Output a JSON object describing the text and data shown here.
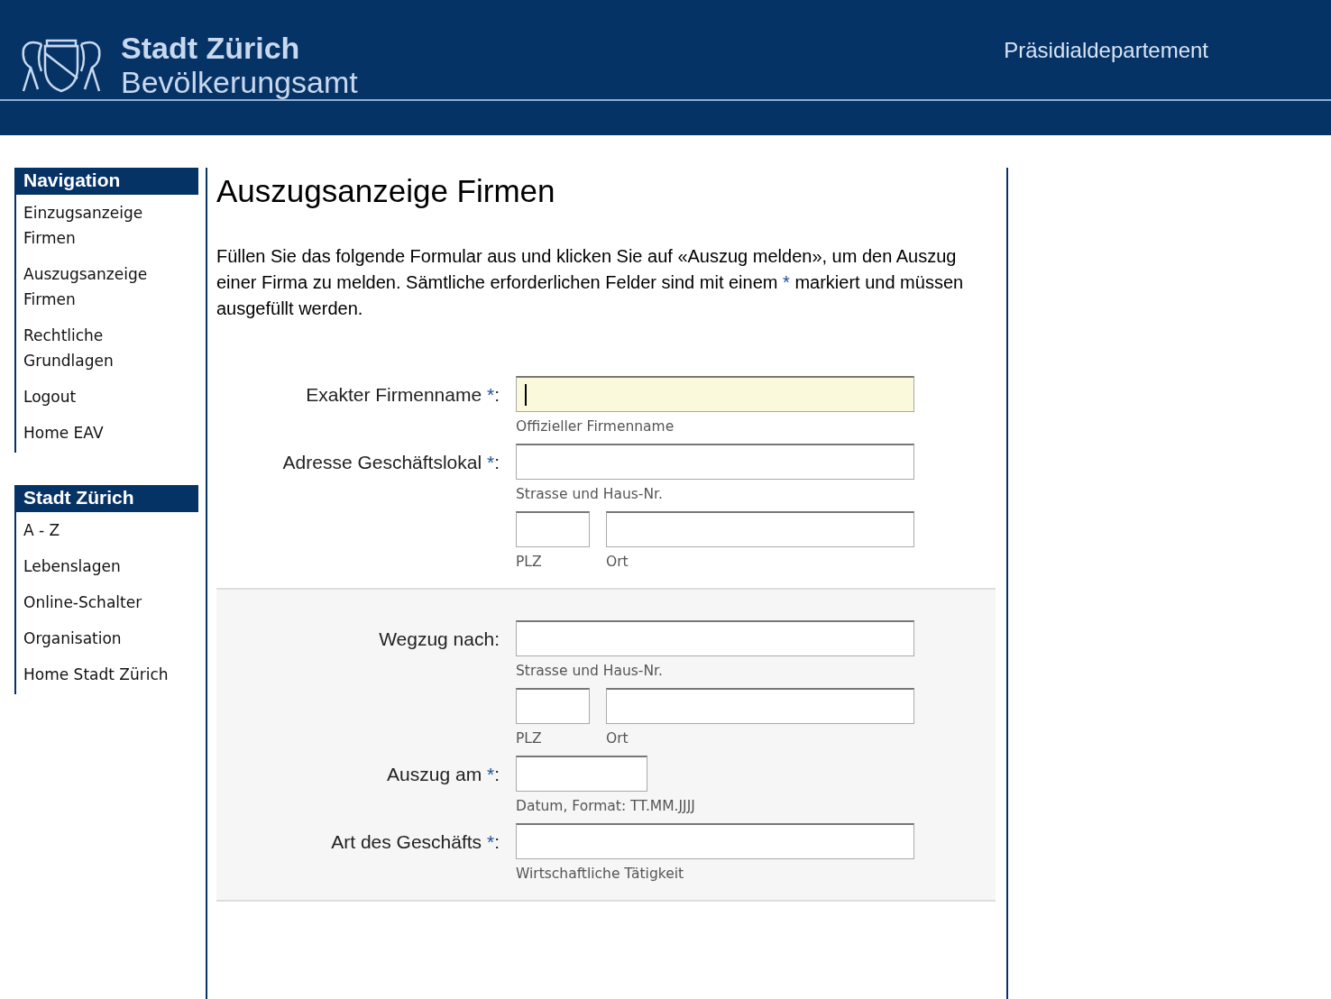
{
  "header": {
    "city": "Stadt Zürich",
    "office": "Bevölkerungsamt",
    "department": "Präsidialdepartement"
  },
  "sidebar": [
    {
      "title": "Navigation",
      "items": [
        "Einzugsanzeige Firmen",
        "Auszugsanzeige Firmen",
        "Rechtliche Grundlagen",
        "Logout",
        "Home EAV"
      ]
    },
    {
      "title": "Stadt Zürich",
      "items": [
        "A - Z",
        "Lebenslagen",
        "Online-Schalter",
        "Organisation",
        "Home Stadt Zürich"
      ]
    }
  ],
  "page": {
    "title": "Auszugsanzeige Firmen",
    "intro": {
      "before": "Füllen Sie das folgende Formular aus und klicken Sie auf «Auszug melden», um den Auszug einer Firma zu melden. Sämtliche erforderlichen Felder sind mit einem ",
      "mark": "*",
      "after": " markiert und müssen ausgefüllt werden."
    }
  },
  "sections": [
    {
      "shaded": false,
      "rows": [
        {
          "kind": "single",
          "label": "Exakter Firmenname ",
          "mark": "*",
          "suffix": ":",
          "focused": true,
          "help": "Offizieller Firmenname"
        },
        {
          "kind": "single",
          "label": "Adresse Geschäftslokal ",
          "mark": "*",
          "suffix": ":",
          "focused": false,
          "help": "Strasse und Haus-Nr."
        },
        {
          "kind": "pair",
          "first_help": "PLZ",
          "second_help": "Ort"
        }
      ]
    },
    {
      "shaded": true,
      "rows": [
        {
          "kind": "single",
          "label": "Wegzug nach:",
          "focused": false,
          "help": "Strasse und Haus-Nr."
        },
        {
          "kind": "pair",
          "first_help": "PLZ",
          "second_help": "Ort"
        },
        {
          "kind": "date",
          "label": "Auszug am ",
          "mark": "*",
          "suffix": ":",
          "focused": false,
          "help": "Datum, Format: TT.MM.JJJJ"
        },
        {
          "kind": "single",
          "label": "Art des Geschäfts ",
          "mark": "*",
          "suffix": ":",
          "focused": false,
          "help": "Wirtschaftliche Tätigkeit"
        }
      ]
    }
  ]
}
